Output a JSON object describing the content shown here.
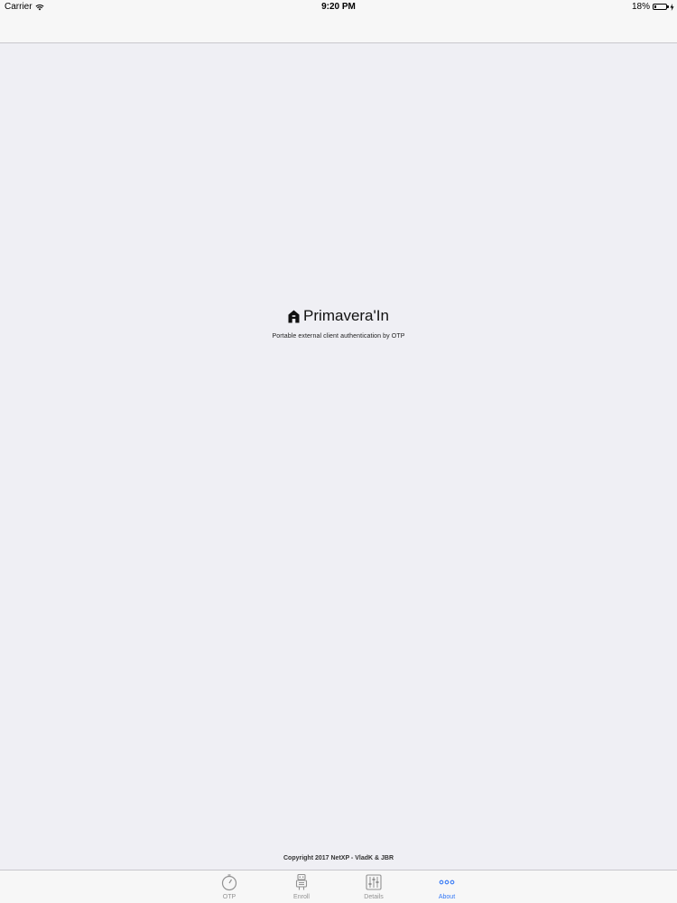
{
  "status_bar": {
    "carrier": "Carrier",
    "time": "9:20 PM",
    "battery_percent": "18%",
    "battery_level": 0.18
  },
  "app": {
    "name": "Primavera'In",
    "tagline": "Portable external client authentication by OTP",
    "copyright": "Copyright 2017 NetXP - VladK & JBR"
  },
  "tabbar": {
    "tabs": [
      {
        "label": "OTP",
        "icon": "timer-icon",
        "active": false
      },
      {
        "label": "Enroll",
        "icon": "robot-icon",
        "active": false
      },
      {
        "label": "Details",
        "icon": "sliders-icon",
        "active": false
      },
      {
        "label": "About",
        "icon": "more-icon",
        "active": true
      }
    ]
  },
  "colors": {
    "accent": "#3478f6",
    "inactive": "#929292",
    "background": "#efeff4",
    "bar": "#f7f7f7"
  }
}
